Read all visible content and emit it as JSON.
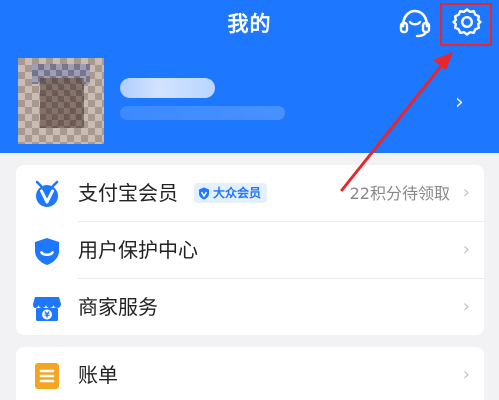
{
  "header": {
    "title": "我的",
    "background_color": "#1d77ff",
    "icons": [
      "headset-icon",
      "gear-icon"
    ],
    "highlight_color": "#e8262b"
  },
  "profile": {
    "chevron": "›"
  },
  "menu_group_1": {
    "items": [
      {
        "label": "支付宝会员",
        "icon": "member-v-icon",
        "badge": "大众会员",
        "right_text": "22积分待领取",
        "chevron": "›"
      },
      {
        "label": "用户保护中心",
        "icon": "shield-icon",
        "chevron": "›"
      },
      {
        "label": "商家服务",
        "icon": "store-icon",
        "chevron": "›"
      }
    ]
  },
  "menu_group_2": {
    "items": [
      {
        "label": "账单",
        "icon": "bill-icon",
        "chevron": "›"
      }
    ]
  }
}
